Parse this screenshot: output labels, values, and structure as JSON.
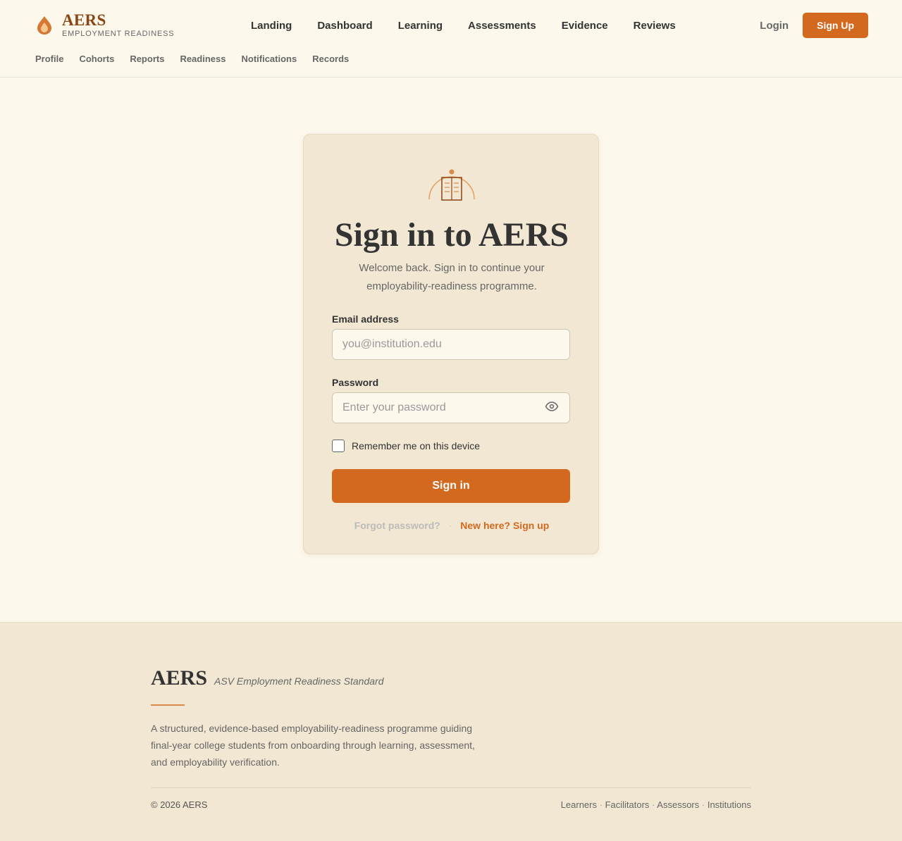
{
  "brand": {
    "name": "AERS",
    "subtitle": "EMPLOYMENT READINESS",
    "accent_color": "#d2691e",
    "logo_icon": "flame-drop-icon"
  },
  "main_nav": [
    "Landing",
    "Dashboard",
    "Learning",
    "Assessments",
    "Evidence",
    "Reviews"
  ],
  "sub_nav": [
    "Profile",
    "Cohorts",
    "Reports",
    "Readiness",
    "Notifications",
    "Records"
  ],
  "auth": {
    "login_label": "Login",
    "signup_label": "Sign Up"
  },
  "signin_card": {
    "icon": "book-arch-icon",
    "title": "Sign in to AERS",
    "subtitle": "Welcome back. Sign in to continue your employability-readiness programme.",
    "email_label": "Email address",
    "email_placeholder": "you@institution.edu",
    "email_value": "",
    "password_label": "Password",
    "password_placeholder": "Enter your password",
    "password_value": "",
    "password_toggle_icon": "eye-icon",
    "remember_label": "Remember me on this device",
    "remember_checked": false,
    "submit_label": "Sign in",
    "forgot_label": "Forgot password?",
    "separator": "·",
    "signup_link_label": "New here? Sign up"
  },
  "footer": {
    "name": "AERS",
    "tagline": "ASV Employment Readiness Standard",
    "description": "A structured, evidence-based employability-readiness programme guiding final-year college students from onboarding through learning, assessment, and employability verification.",
    "copyright": "© 2026 AERS",
    "links": [
      "Learners",
      "Facilitators",
      "Assessors",
      "Institutions"
    ]
  }
}
